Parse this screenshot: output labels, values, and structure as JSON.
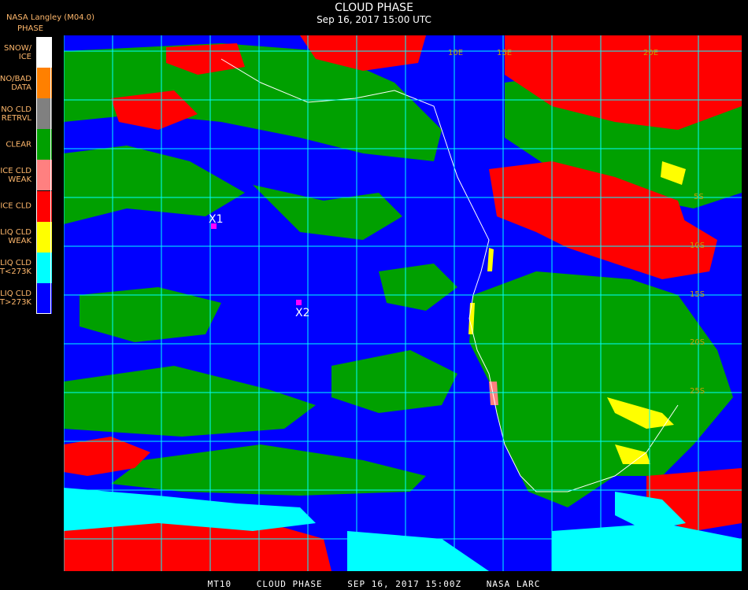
{
  "header": {
    "agency": "NASA Langley (M04.0)",
    "legend_title": "PHASE",
    "title": "CLOUD PHASE",
    "datetime": "Sep 16, 2017 15:00 UTC"
  },
  "legend": [
    {
      "label": "SNOW/\nICE",
      "color": "#ffffff"
    },
    {
      "label": "NO/BAD\nDATA",
      "color": "#ff8000"
    },
    {
      "label": "NO CLD\nRETRVL",
      "color": "#808080"
    },
    {
      "label": "CLEAR",
      "color": "#00a000"
    },
    {
      "label": "ICE CLD\nWEAK",
      "color": "#ff8080"
    },
    {
      "label": "ICE CLD",
      "color": "#ff0000"
    },
    {
      "label": "LIQ CLD\nWEAK",
      "color": "#ffff00"
    },
    {
      "label": "LIQ CLD\nT<273K",
      "color": "#00ffff"
    },
    {
      "label": "LIQ CLD\nT>273K",
      "color": "#0000ff"
    }
  ],
  "markers": [
    {
      "label": "X1"
    },
    {
      "label": "X2"
    }
  ],
  "grid_labels": [
    "5S",
    "10S",
    "15S",
    "20S",
    "25S",
    "10E",
    "15E",
    "20E"
  ],
  "footer": {
    "product": "MT10",
    "name": "CLOUD PHASE",
    "date": "SEP 16, 2017 15:00Z",
    "org": "NASA LARC"
  }
}
